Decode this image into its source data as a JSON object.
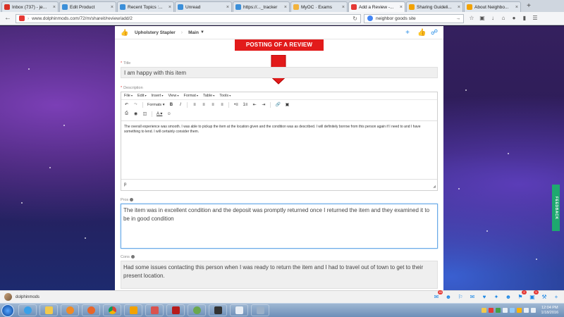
{
  "browser": {
    "tabs": [
      {
        "label": "Inbox (737) - je...",
        "icon": "gmail-icon",
        "color": "#d93025",
        "active": false
      },
      {
        "label": "Edit Product",
        "icon": "site-icon",
        "color": "#3b8fd9",
        "active": false
      },
      {
        "label": "Recent Topics :...",
        "icon": "site-icon",
        "color": "#3b8fd9",
        "active": false
      },
      {
        "label": "Unread",
        "icon": "site-icon",
        "color": "#3b8fd9",
        "active": false
      },
      {
        "label": "https://..._tracker",
        "icon": "site-icon",
        "color": "#3b8fd9",
        "active": false
      },
      {
        "label": "MyOC · Exams",
        "icon": "myoc-icon",
        "color": "#f2b33d",
        "active": false
      },
      {
        "label": "Add a Review -...",
        "icon": "dolphin-icon",
        "color": "#e53935",
        "active": true
      },
      {
        "label": "Sharing Guideli...",
        "icon": "site-icon",
        "color": "#f2a200",
        "active": false
      },
      {
        "label": "About Neighbo...",
        "icon": "site-icon",
        "color": "#f2a200",
        "active": false
      }
    ],
    "url": "www.dolphinmods.com/72/m/shareit/review/add/2",
    "search": "neighbor goods site"
  },
  "app": {
    "breadcrumb_item": "Upholstery Stapler",
    "breadcrumb_section": "Main"
  },
  "annotation": {
    "banner": "POSTING OF A REVIEW"
  },
  "form": {
    "title_label": "Title",
    "title_value": "I am happy with this item",
    "description_label": "Description",
    "menubar": [
      "File",
      "Edit",
      "Insert",
      "View",
      "Format",
      "Table",
      "Tools"
    ],
    "formats_label": "Formats",
    "description_text": "The overall experience was smooth. I was able to pickup the item at the location given and the condition was as described. I will definitely borrow from this person again if I need to and I have something to lend. I will certainly consider them.",
    "editor_status": "p",
    "pros_label": "Pros",
    "pros_value": "The item was in excellent condition and the deposit was promptly returned once I returned the item and they examined it to be in good condition",
    "cons_label": "Cons",
    "cons_value": "Had some issues contacting this person when I was ready to return the item and I had to travel out of town to get to their present location."
  },
  "feedback_tab": "FEEDBACK",
  "bottombar": {
    "username": "dolphinmods",
    "badges": {
      "mail": "16",
      "notifications": "2",
      "cart": "5"
    }
  },
  "taskbar": {
    "time": "12:04 PM",
    "date": "1/18/2016"
  },
  "colors": {
    "accent": "#1e88e5",
    "annotation_red": "#e21b1b",
    "feedback_green": "#1ea86f"
  }
}
